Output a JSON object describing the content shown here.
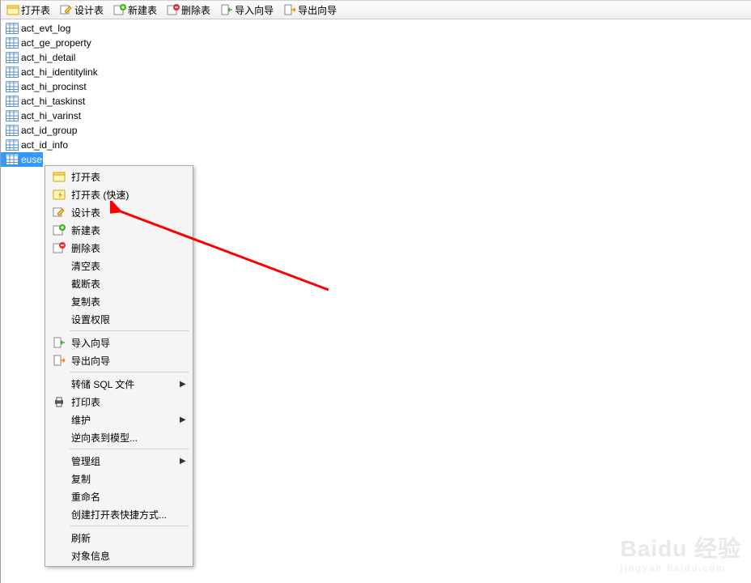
{
  "toolbar": {
    "open": "打开表",
    "design": "设计表",
    "new": "新建表",
    "delete": "删除表",
    "import": "导入向导",
    "export": "导出向导"
  },
  "tables": [
    "act_evt_log",
    "act_ge_property",
    "act_hi_detail",
    "act_hi_identitylink",
    "act_hi_procinst",
    "act_hi_taskinst",
    "act_hi_varinst",
    "act_id_group",
    "act_id_info",
    "euse"
  ],
  "menu": {
    "open": "打开表",
    "openFast": "打开表 (快速)",
    "design": "设计表",
    "new": "新建表",
    "delete": "删除表",
    "empty": "清空表",
    "truncate": "截断表",
    "copy": "复制表",
    "perm": "设置权限",
    "import": "导入向导",
    "export": "导出向导",
    "dump": "转储 SQL 文件",
    "print": "打印表",
    "maintain": "维护",
    "reverse": "逆向表到模型...",
    "group": "管理组",
    "copyItem": "复制",
    "rename": "重命名",
    "shortcut": "创建打开表快捷方式...",
    "refresh": "刷新",
    "info": "对象信息"
  },
  "watermark": {
    "brand": "Baidu 经验",
    "sub": "jingyan.baidu.com"
  }
}
